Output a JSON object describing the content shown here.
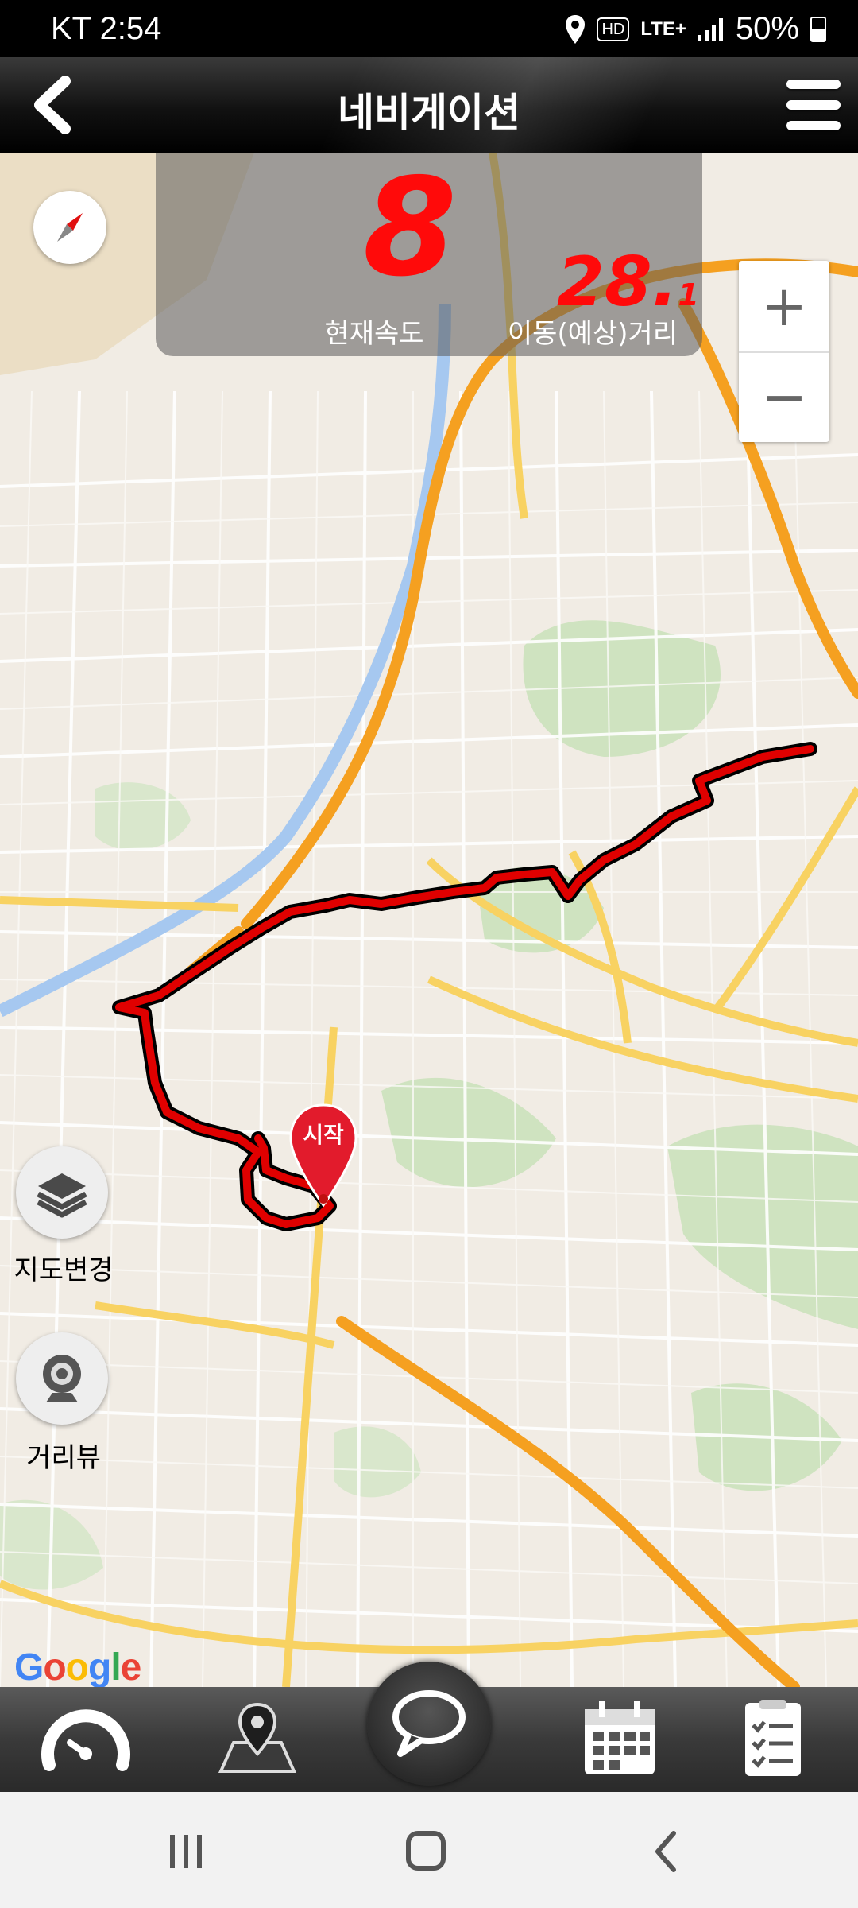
{
  "status_bar": {
    "carrier_time": "KT 2:54",
    "hd": "HD",
    "lte": "LTE+",
    "battery": "50%",
    "icons": [
      "location-icon",
      "signal-icon",
      "battery-icon"
    ]
  },
  "header": {
    "title": "네비게이션",
    "back_icon": "chevron-left-icon",
    "menu_icon": "hamburger-menu-icon"
  },
  "speed_panel": {
    "current_speed": "8",
    "current_speed_label": "현재속도",
    "distance_main": "28.",
    "distance_decimal": "1",
    "distance_label": "이동(예상)거리"
  },
  "map": {
    "start_marker_label": "시작",
    "zoom_in": "+",
    "zoom_out": "−",
    "layer_button_label": "지도변경",
    "street_view_label": "거리뷰",
    "provider": "Google",
    "route_color": "#e00000",
    "highway_color": "#f5a020"
  },
  "tabbar": {
    "tabs": [
      "speedometer-icon",
      "map-pin-icon",
      "chat-bubble-icon",
      "calendar-icon",
      "checklist-icon"
    ]
  },
  "navbar": {
    "buttons": [
      "recent-apps-icon",
      "home-icon",
      "back-icon"
    ]
  }
}
